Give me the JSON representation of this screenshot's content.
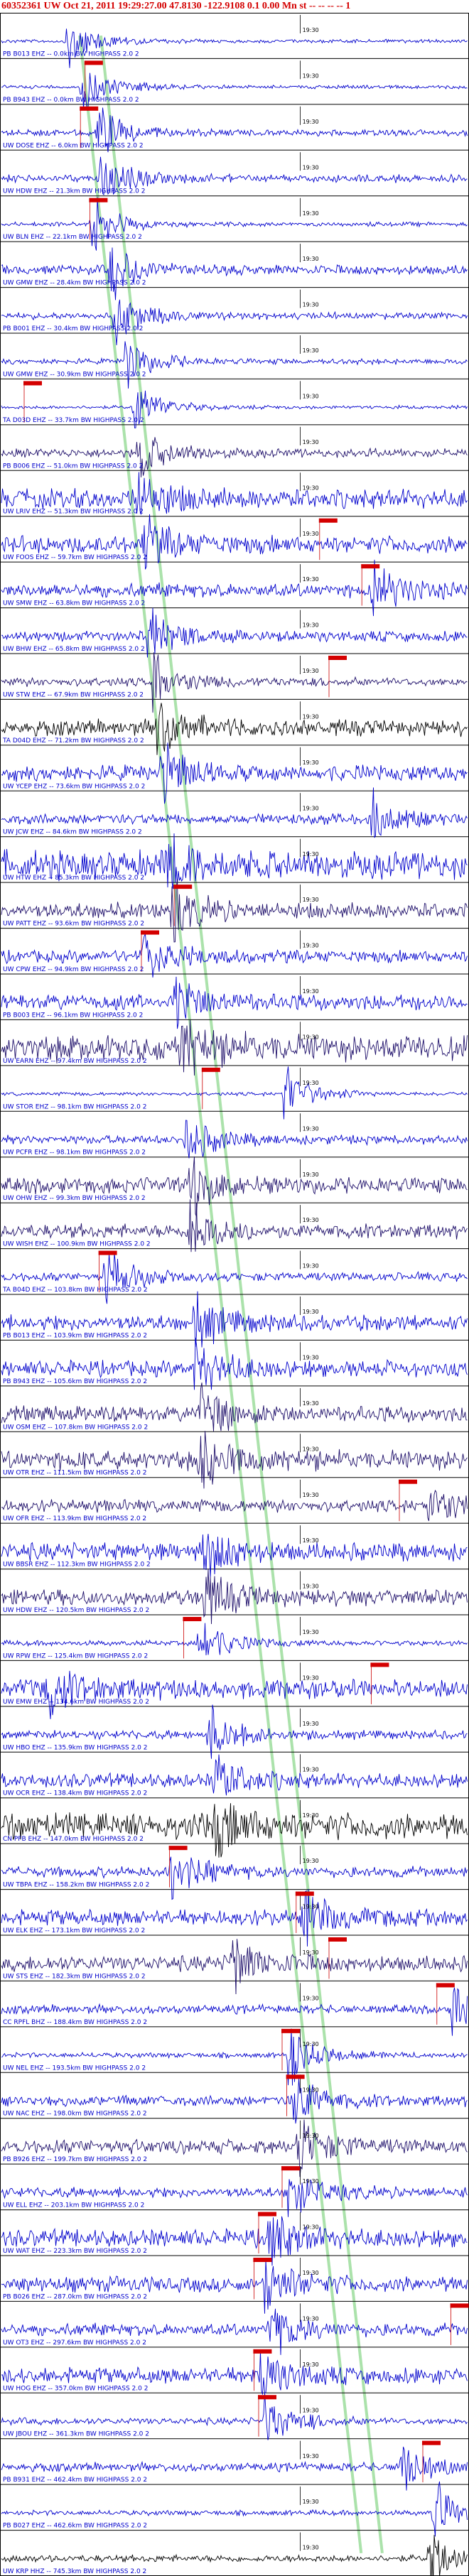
{
  "header": {
    "title": "60352361 UW Oct 21, 2011 19:29:27.00   47.8130 -122.9108  0.1 0.00 Mn st -- -- -- -- 1",
    "title_color": "#d40000"
  },
  "colors": {
    "trace_a": "#0000cc",
    "trace_b": "#1e0f6a",
    "trace_c": "#000000",
    "pick": "#d40000",
    "pick_line": "#cc0000",
    "arrival": "#8fd88f",
    "label": "#0000cc",
    "frame": "#000000",
    "time_mark": "#000000"
  },
  "time_label": "19:30",
  "filter_note": "HIGHPASS  2.0  2",
  "traces": [
    {
      "label": "PB B013 EHZ -- 0.0km BW  HIGHPASS  2.0  2",
      "tone": "a",
      "amp": 0.1,
      "event": 0.15,
      "pick": 0.18,
      "pick_flag": false
    },
    {
      "label": "PB B943 EHZ -- 0.0km BW  HIGHPASS  2.0  2",
      "tone": "a",
      "amp": 0.1,
      "event": 0.18,
      "pick": 0.18,
      "pick_flag": true
    },
    {
      "label": "UW DOSE EHZ -- 6.0km BW  HIGHPASS  2.0  2",
      "tone": "a",
      "amp": 0.18,
      "event": 0.21,
      "pick": 0.17,
      "pick_flag": true
    },
    {
      "label": "UW HDW EHZ -- 21.3km BW  HIGHPASS  2.0  2",
      "tone": "a",
      "amp": 0.22,
      "event": 0.22,
      "pick": 0.17,
      "pick_flag": false
    },
    {
      "label": "UW BLN EHZ -- 22.1km BW  HIGHPASS  2.0  2",
      "tone": "a",
      "amp": 0.12,
      "event": 0.2,
      "pick": 0.19,
      "pick_flag": true
    },
    {
      "label": "UW GMW EHZ -- 28.4km BW  HIGHPASS  2.0  2",
      "tone": "a",
      "amp": 0.28,
      "event": 0.24,
      "pick": 0.2,
      "pick_flag": false
    },
    {
      "label": "PB B001 EHZ -- 30.4km BW  HIGHPASS  2.0  2",
      "tone": "a",
      "amp": 0.2,
      "event": 0.25,
      "pick": 0.2,
      "pick_flag": false
    },
    {
      "label": "UW GMW EHZ -- 30.9km BW  HIGHPASS  2.0  2",
      "tone": "a",
      "amp": 0.16,
      "event": 0.27,
      "pick": 0.21,
      "pick_flag": false
    },
    {
      "label": "TA D03D EHZ -- 33.7km BW  HIGHPASS  2.0  2",
      "tone": "a",
      "amp": 0.1,
      "event": 0.29,
      "pick": 0.05,
      "pick_flag": true
    },
    {
      "label": "PB B006 EHZ -- 51.0km BW  HIGHPASS  2.0  2",
      "tone": "b",
      "amp": 0.25,
      "event": 0.3,
      "pick": 0.06,
      "pick_flag": false
    },
    {
      "label": "UW LRIV EHZ -- 51.3km BW  HIGHPASS  2.0  2",
      "tone": "a",
      "amp": 0.55,
      "event": 0.3,
      "pick": 0.06,
      "pick_flag": false
    },
    {
      "label": "UW FOOS EHZ -- 59.7km BW  HIGHPASS  2.0  2",
      "tone": "a",
      "amp": 0.5,
      "event": 0.31,
      "pick": 0.68,
      "pick_flag": true
    },
    {
      "label": "UW SMW EHZ -- 63.8km BW  HIGHPASS  2.0  2",
      "tone": "a",
      "amp": 0.4,
      "event": 0.8,
      "pick": 0.77,
      "pick_flag": true
    },
    {
      "label": "UW BHW EHZ -- 65.8km BW  HIGHPASS  2.0  2",
      "tone": "a",
      "amp": 0.3,
      "event": 0.32,
      "pick": 0.3,
      "pick_flag": false
    },
    {
      "label": "UW STW EHZ -- 67.9km BW  HIGHPASS  2.0  2",
      "tone": "b",
      "amp": 0.25,
      "event": 0.33,
      "pick": 0.7,
      "pick_flag": true
    },
    {
      "label": "TA D04D EHZ -- 71.2km BW  HIGHPASS  2.0  2",
      "tone": "c",
      "amp": 0.45,
      "event": 0.34,
      "pick": 0.32,
      "pick_flag": false
    },
    {
      "label": "UW YCEP EHZ -- 73.6km BW  HIGHPASS  2.0  2",
      "tone": "a",
      "amp": 0.45,
      "event": 0.35,
      "pick": 0.33,
      "pick_flag": false
    },
    {
      "label": "UW JCW EHZ -- 84.6km BW  HIGHPASS  2.0  2",
      "tone": "a",
      "amp": 0.3,
      "event": 0.8,
      "pick": 0.33,
      "pick_flag": false
    },
    {
      "label": "UW HTW EHZ -- 85.3km BW  HIGHPASS  2.0  2",
      "tone": "a",
      "amp": 0.8,
      "event": 0.36,
      "pick": 0.34,
      "pick_flag": false
    },
    {
      "label": "UW PATT EHZ -- 93.6km BW  HIGHPASS  2.0  2",
      "tone": "b",
      "amp": 0.45,
      "event": 0.37,
      "pick": 0.37,
      "pick_flag": true
    },
    {
      "label": "UW CPW EHZ -- 94.9km BW  HIGHPASS  2.0  2",
      "tone": "a",
      "amp": 0.35,
      "event": 0.31,
      "pick": 0.3,
      "pick_flag": true
    },
    {
      "label": "PB B003 EHZ -- 96.1km BW  HIGHPASS  2.0  2",
      "tone": "a",
      "amp": 0.45,
      "event": 0.38,
      "pick": 0.36,
      "pick_flag": false
    },
    {
      "label": "UW EARN EHZ -- 97.4km BW  HIGHPASS  2.0  2",
      "tone": "b",
      "amp": 0.75,
      "event": 0.39,
      "pick": 0.36,
      "pick_flag": false
    },
    {
      "label": "UW STOR EHZ -- 98.1km BW  HIGHPASS  2.0  2",
      "tone": "a",
      "amp": 0.1,
      "event": 0.61,
      "pick": 0.43,
      "pick_flag": true
    },
    {
      "label": "UW PCFR EHZ -- 98.1km BW  HIGHPASS  2.0  2",
      "tone": "a",
      "amp": 0.25,
      "event": 0.4,
      "pick": 0.38,
      "pick_flag": false
    },
    {
      "label": "UW OHW EHZ -- 99.3km BW  HIGHPASS  2.0  2",
      "tone": "b",
      "amp": 0.45,
      "event": 0.41,
      "pick": 0.39,
      "pick_flag": false
    },
    {
      "label": "UW WISH EHZ -- 100.9km BW  HIGHPASS  2.0  2",
      "tone": "b",
      "amp": 0.4,
      "event": 0.41,
      "pick": 0.39,
      "pick_flag": false
    },
    {
      "label": "TA B04D EHZ -- 103.8km BW  HIGHPASS  2.0  2",
      "tone": "a",
      "amp": 0.25,
      "event": 0.23,
      "pick": 0.21,
      "pick_flag": true
    },
    {
      "label": "PB B013 EHZ -- 103.9km BW  HIGHPASS  2.0  2",
      "tone": "a",
      "amp": 0.45,
      "event": 0.42,
      "pick": 0.4,
      "pick_flag": false
    },
    {
      "label": "PB B943 EHZ -- 105.6km BW  HIGHPASS  2.0  2",
      "tone": "a",
      "amp": 0.45,
      "event": 0.42,
      "pick": 0.4,
      "pick_flag": false
    },
    {
      "label": "UW OSM EHZ -- 107.8km BW  HIGHPASS  2.0  2",
      "tone": "b",
      "amp": 0.45,
      "event": 0.43,
      "pick": 0.41,
      "pick_flag": false
    },
    {
      "label": "UW OTR EHZ -- 111.5km BW  HIGHPASS  2.0  2",
      "tone": "b",
      "amp": 0.55,
      "event": 0.43,
      "pick": 0.41,
      "pick_flag": false
    },
    {
      "label": "UW OFR EHZ -- 113.9km BW  HIGHPASS  2.0  2",
      "tone": "b",
      "amp": 0.35,
      "event": 0.92,
      "pick": 0.85,
      "pick_flag": true
    },
    {
      "label": "UW BBSR EHZ -- 112.3km BW  HIGHPASS  2.0  2",
      "tone": "a",
      "amp": 0.5,
      "event": 0.44,
      "pick": 0.42,
      "pick_flag": false
    },
    {
      "label": "UW HDW EHZ -- 120.5km BW  HIGHPASS  2.0  2",
      "tone": "b",
      "amp": 0.45,
      "event": 0.44,
      "pick": 0.42,
      "pick_flag": false
    },
    {
      "label": "UW RPW EHZ -- 125.4km BW  HIGHPASS  2.0  2",
      "tone": "a",
      "amp": 0.15,
      "event": 0.43,
      "pick": 0.39,
      "pick_flag": true
    },
    {
      "label": "UW EMW EHZ -- 134.6km BW  HIGHPASS  2.0  2",
      "tone": "a",
      "amp": 0.55,
      "event": 0.1,
      "pick": 0.79,
      "pick_flag": true
    },
    {
      "label": "UW HBO EHZ -- 135.9km BW  HIGHPASS  2.0  2",
      "tone": "a",
      "amp": 0.25,
      "event": 0.45,
      "pick": 0.43,
      "pick_flag": false
    },
    {
      "label": "UW OCR EHZ -- 138.4km BW  HIGHPASS  2.0  2",
      "tone": "a",
      "amp": 0.4,
      "event": 0.46,
      "pick": 0.44,
      "pick_flag": false
    },
    {
      "label": "CN PFB EHZ -- 147.0km BW  HIGHPASS  2.0  2",
      "tone": "c",
      "amp": 0.75,
      "event": 0.46,
      "pick": 0.44,
      "pick_flag": false
    },
    {
      "label": "UW TBPA EHZ -- 158.2km BW  HIGHPASS  2.0  2",
      "tone": "a",
      "amp": 0.3,
      "event": 0.37,
      "pick": 0.36,
      "pick_flag": true
    },
    {
      "label": "UW ELK EHZ -- 173.1km BW  HIGHPASS  2.0  2",
      "tone": "a",
      "amp": 0.45,
      "event": 0.65,
      "pick": 0.63,
      "pick_flag": true
    },
    {
      "label": "UW STS EHZ -- 182.3km BW  HIGHPASS  2.0  2",
      "tone": "b",
      "amp": 0.45,
      "event": 0.5,
      "pick": 0.7,
      "pick_flag": true
    },
    {
      "label": "CC RPFL BHZ -- 188.4km BW  HIGHPASS  2.0  2",
      "tone": "a",
      "amp": 0.25,
      "event": 0.97,
      "pick": 0.93,
      "pick_flag": true
    },
    {
      "label": "UW NEL EHZ -- 193.5km BW  HIGHPASS  2.0  2",
      "tone": "a",
      "amp": 0.15,
      "event": 0.62,
      "pick": 0.6,
      "pick_flag": true
    },
    {
      "label": "UW NAC EHZ -- 198.0km BW  HIGHPASS  2.0  2",
      "tone": "a",
      "amp": 0.3,
      "event": 0.63,
      "pick": 0.61,
      "pick_flag": true
    },
    {
      "label": "PB B926 EHZ -- 199.7km BW  HIGHPASS  2.0  2",
      "tone": "b",
      "amp": 0.4,
      "event": 0.64,
      "pick": 0.62,
      "pick_flag": false
    },
    {
      "label": "UW ELL EHZ -- 203.1km BW  HIGHPASS  2.0  2",
      "tone": "a",
      "amp": 0.3,
      "event": 0.62,
      "pick": 0.6,
      "pick_flag": true
    },
    {
      "label": "UW WAT EHZ -- 223.3km BW  HIGHPASS  2.0  2",
      "tone": "a",
      "amp": 0.5,
      "event": 0.58,
      "pick": 0.55,
      "pick_flag": true
    },
    {
      "label": "PB B026 EHZ -- 287.0km BW  HIGHPASS  2.0  2",
      "tone": "a",
      "amp": 0.45,
      "event": 0.57,
      "pick": 0.54,
      "pick_flag": true
    },
    {
      "label": "UW OT3 EHZ -- 297.6km BW  HIGHPASS  2.0  2",
      "tone": "a",
      "amp": 0.35,
      "event": 0.58,
      "pick": 0.96,
      "pick_flag": true
    },
    {
      "label": "UW HOG EHZ -- 357.0km BW  HIGHPASS  2.0  2",
      "tone": "a",
      "amp": 0.45,
      "event": 0.56,
      "pick": 0.54,
      "pick_flag": true
    },
    {
      "label": "UW JBOU EHZ -- 361.3km BW  HIGHPASS  2.0  2",
      "tone": "a",
      "amp": 0.2,
      "event": 0.57,
      "pick": 0.55,
      "pick_flag": true
    },
    {
      "label": "PB B931 EHZ -- 462.4km BW  HIGHPASS  2.0  2",
      "tone": "a",
      "amp": 0.25,
      "event": 0.86,
      "pick": 0.9,
      "pick_flag": true
    },
    {
      "label": "PB B027 EHZ -- 462.6km BW  HIGHPASS  2.0  2",
      "tone": "a",
      "amp": 0.15,
      "event": 0.93,
      "pick": 0.91,
      "pick_flag": false
    },
    {
      "label": "UW KRP HHZ -- 745.3km BW  HIGHPASS  2.0  2",
      "tone": "c",
      "amp": 0.2,
      "event": 0.92,
      "pick": 0.9,
      "pick_flag": false
    }
  ]
}
